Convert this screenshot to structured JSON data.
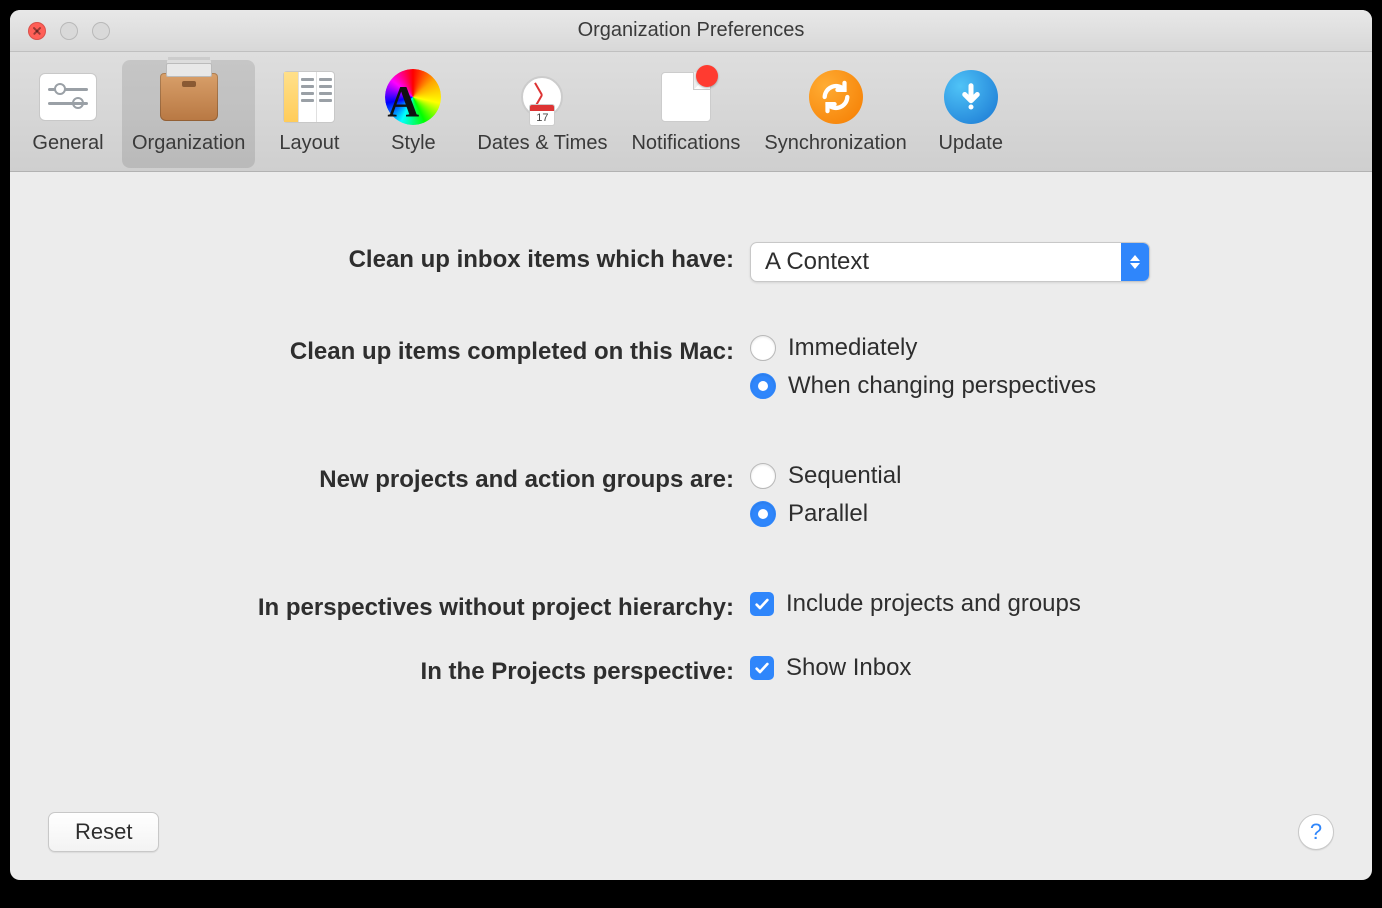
{
  "window": {
    "title": "Organization Preferences"
  },
  "toolbar": {
    "tabs": [
      {
        "id": "general",
        "label": "General"
      },
      {
        "id": "organization",
        "label": "Organization"
      },
      {
        "id": "layout",
        "label": "Layout"
      },
      {
        "id": "style",
        "label": "Style"
      },
      {
        "id": "dates",
        "label": "Dates & Times"
      },
      {
        "id": "notifications",
        "label": "Notifications"
      },
      {
        "id": "synchronization",
        "label": "Synchronization"
      },
      {
        "id": "update",
        "label": "Update"
      }
    ],
    "active": "organization",
    "calendar_day": "17"
  },
  "form": {
    "cleanup_inbox": {
      "label": "Clean up inbox items which have:",
      "selected": "A Context"
    },
    "cleanup_completed": {
      "label": "Clean up items completed on this Mac:",
      "option_immediately": "Immediately",
      "option_changing": "When changing perspectives",
      "selected": "changing"
    },
    "new_projects": {
      "label": "New projects and action groups are:",
      "option_sequential": "Sequential",
      "option_parallel": "Parallel",
      "selected": "parallel"
    },
    "without_hierarchy": {
      "label": "In perspectives without project hierarchy:",
      "checkbox_label": "Include projects and groups",
      "checked": true
    },
    "projects_perspective": {
      "label": "In the Projects perspective:",
      "checkbox_label": "Show Inbox",
      "checked": true
    }
  },
  "footer": {
    "reset": "Reset",
    "help": "?"
  }
}
